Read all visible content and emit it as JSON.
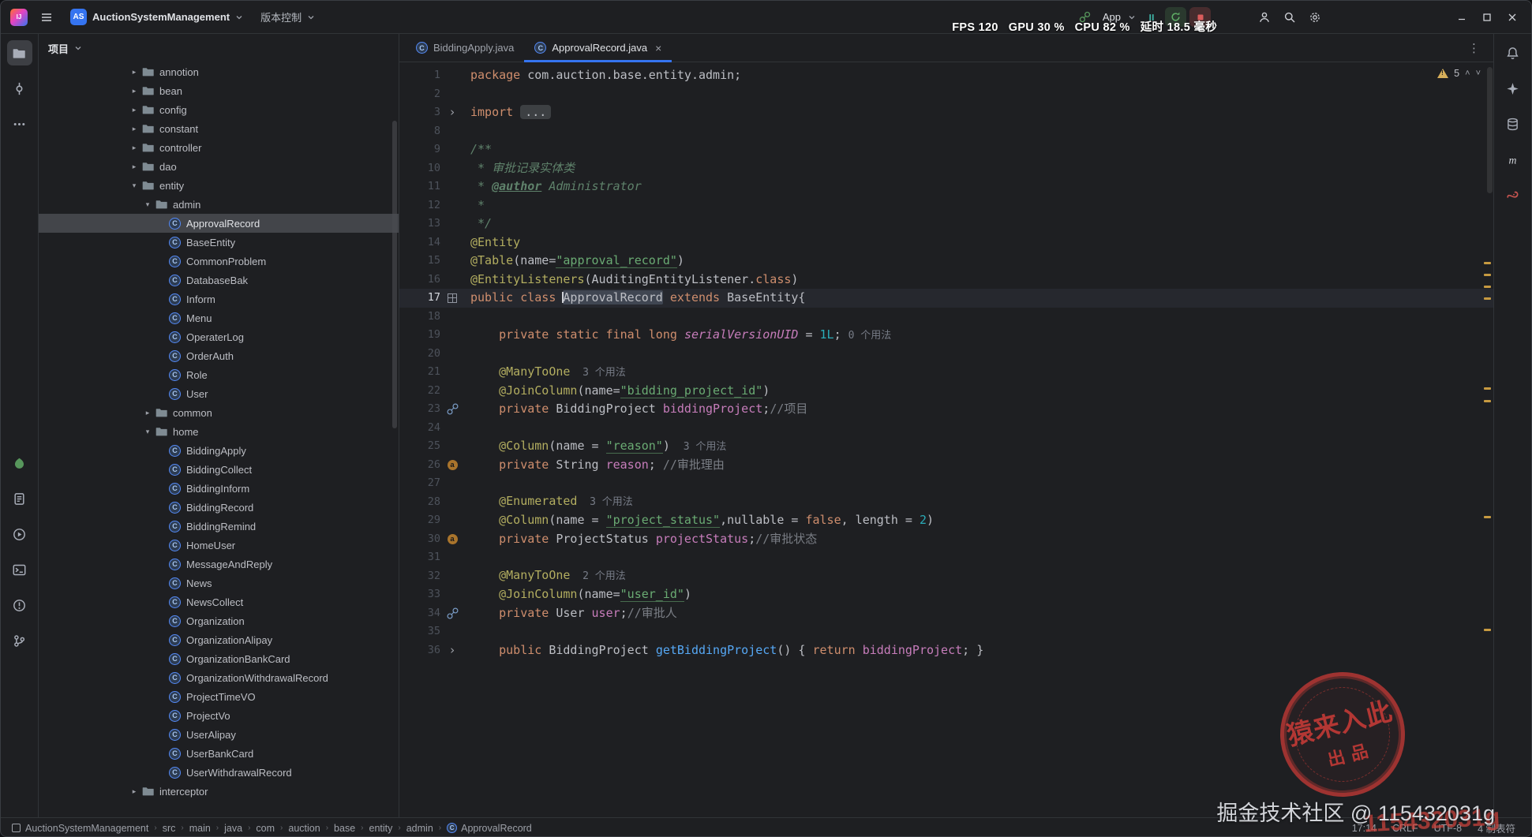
{
  "titlebar": {
    "project_abbrev": "AS",
    "project_name": "AuctionSystemManagement",
    "vcs_widget": "版本控制",
    "run_config": "App",
    "perf_text": "FPS 120   GPU 30 %   CPU 82 %   延时 18.5 毫秒"
  },
  "panel": {
    "title": "项目"
  },
  "tree": {
    "items": [
      {
        "label": "annotion",
        "depth": 0,
        "kind": "folder",
        "state": "c"
      },
      {
        "label": "bean",
        "depth": 0,
        "kind": "folder",
        "state": "c"
      },
      {
        "label": "config",
        "depth": 0,
        "kind": "folder",
        "state": "c"
      },
      {
        "label": "constant",
        "depth": 0,
        "kind": "folder",
        "state": "c"
      },
      {
        "label": "controller",
        "depth": 0,
        "kind": "folder",
        "state": "c"
      },
      {
        "label": "dao",
        "depth": 0,
        "kind": "folder",
        "state": "c"
      },
      {
        "label": "entity",
        "depth": 0,
        "kind": "folder",
        "state": "e"
      },
      {
        "label": "admin",
        "depth": 1,
        "kind": "folder",
        "state": "e"
      },
      {
        "label": "ApprovalRecord",
        "depth": 2,
        "kind": "class",
        "selected": true
      },
      {
        "label": "BaseEntity",
        "depth": 2,
        "kind": "class"
      },
      {
        "label": "CommonProblem",
        "depth": 2,
        "kind": "class"
      },
      {
        "label": "DatabaseBak",
        "depth": 2,
        "kind": "class"
      },
      {
        "label": "Inform",
        "depth": 2,
        "kind": "class"
      },
      {
        "label": "Menu",
        "depth": 2,
        "kind": "class"
      },
      {
        "label": "OperaterLog",
        "depth": 2,
        "kind": "class"
      },
      {
        "label": "OrderAuth",
        "depth": 2,
        "kind": "class"
      },
      {
        "label": "Role",
        "depth": 2,
        "kind": "class"
      },
      {
        "label": "User",
        "depth": 2,
        "kind": "class"
      },
      {
        "label": "common",
        "depth": 1,
        "kind": "folder",
        "state": "c"
      },
      {
        "label": "home",
        "depth": 1,
        "kind": "folder",
        "state": "e"
      },
      {
        "label": "BiddingApply",
        "depth": 2,
        "kind": "class"
      },
      {
        "label": "BiddingCollect",
        "depth": 2,
        "kind": "class"
      },
      {
        "label": "BiddingInform",
        "depth": 2,
        "kind": "class"
      },
      {
        "label": "BiddingRecord",
        "depth": 2,
        "kind": "class"
      },
      {
        "label": "BiddingRemind",
        "depth": 2,
        "kind": "class"
      },
      {
        "label": "HomeUser",
        "depth": 2,
        "kind": "class"
      },
      {
        "label": "MessageAndReply",
        "depth": 2,
        "kind": "class"
      },
      {
        "label": "News",
        "depth": 2,
        "kind": "class"
      },
      {
        "label": "NewsCollect",
        "depth": 2,
        "kind": "class"
      },
      {
        "label": "Organization",
        "depth": 2,
        "kind": "class"
      },
      {
        "label": "OrganizationAlipay",
        "depth": 2,
        "kind": "class"
      },
      {
        "label": "OrganizationBankCard",
        "depth": 2,
        "kind": "class"
      },
      {
        "label": "OrganizationWithdrawalRecord",
        "depth": 2,
        "kind": "class"
      },
      {
        "label": "ProjectTimeVO",
        "depth": 2,
        "kind": "class"
      },
      {
        "label": "ProjectVo",
        "depth": 2,
        "kind": "class"
      },
      {
        "label": "UserAlipay",
        "depth": 2,
        "kind": "class"
      },
      {
        "label": "UserBankCard",
        "depth": 2,
        "kind": "class"
      },
      {
        "label": "UserWithdrawalRecord",
        "depth": 2,
        "kind": "class"
      },
      {
        "label": "interceptor",
        "depth": 0,
        "kind": "folder",
        "state": "c"
      }
    ]
  },
  "tabs": [
    {
      "label": "BiddingApply.java",
      "active": false
    },
    {
      "label": "ApprovalRecord.java",
      "active": true
    }
  ],
  "editor": {
    "inspections": {
      "warnings": "5"
    },
    "lines": [
      {
        "n": "1",
        "s": [
          [
            "kw",
            "package "
          ],
          [
            "pl",
            "com.auction.base.entity.admin;"
          ]
        ]
      },
      {
        "n": "2",
        "s": []
      },
      {
        "n": "3",
        "g": "fold",
        "s": [
          [
            "kw",
            "import "
          ],
          [
            "foldb",
            "..."
          ]
        ]
      },
      {
        "n": "8",
        "s": []
      },
      {
        "n": "9",
        "s": [
          [
            "doc",
            "/**"
          ]
        ]
      },
      {
        "n": "10",
        "s": [
          [
            "doc",
            " * 审批记录实体类"
          ]
        ]
      },
      {
        "n": "11",
        "s": [
          [
            "doc",
            " * "
          ],
          [
            "dtag",
            "@author"
          ],
          [
            "doc",
            " Administrator"
          ]
        ]
      },
      {
        "n": "12",
        "s": [
          [
            "doc",
            " *"
          ]
        ]
      },
      {
        "n": "13",
        "s": [
          [
            "doc",
            " */"
          ]
        ]
      },
      {
        "n": "14",
        "s": [
          [
            "ann",
            "@Entity"
          ]
        ]
      },
      {
        "n": "15",
        "s": [
          [
            "ann",
            "@Table"
          ],
          [
            "pl",
            "(name="
          ],
          [
            "su",
            "\"approval_record\""
          ],
          [
            "pl",
            ")"
          ]
        ]
      },
      {
        "n": "16",
        "s": [
          [
            "ann",
            "@EntityListeners"
          ],
          [
            "pl",
            "(AuditingEntityListener."
          ],
          [
            "kw",
            "class"
          ],
          [
            "pl",
            ")"
          ]
        ]
      },
      {
        "n": "17",
        "cur": true,
        "g": "entity",
        "s": [
          [
            "kw",
            "public class "
          ],
          [
            "hlt",
            "ApprovalRecord"
          ],
          [
            "kw",
            " extends "
          ],
          [
            "pl",
            "BaseEntity{"
          ]
        ]
      },
      {
        "n": "18",
        "s": []
      },
      {
        "n": "19",
        "s": [
          [
            "kw",
            "    private static final long "
          ],
          [
            "flds",
            "serialVersionUID"
          ],
          [
            "pl",
            " = "
          ],
          [
            "num",
            "1L"
          ],
          [
            "pl",
            "; "
          ],
          [
            "hint",
            "0 个用法"
          ]
        ]
      },
      {
        "n": "20",
        "s": []
      },
      {
        "n": "21",
        "s": [
          [
            "ann",
            "    @ManyToOne"
          ],
          [
            "hint",
            "  3 个用法"
          ]
        ]
      },
      {
        "n": "22",
        "s": [
          [
            "ann",
            "    @JoinColumn"
          ],
          [
            "pl",
            "(name="
          ],
          [
            "su",
            "\"bidding_project_id\""
          ],
          [
            "pl",
            ")"
          ]
        ]
      },
      {
        "n": "23",
        "g": "link",
        "s": [
          [
            "kw",
            "    private "
          ],
          [
            "pl",
            "BiddingProject "
          ],
          [
            "fld",
            "biddingProject"
          ],
          [
            "pl",
            ";"
          ],
          [
            "cmt",
            "//项目"
          ]
        ]
      },
      {
        "n": "24",
        "s": []
      },
      {
        "n": "25",
        "s": [
          [
            "ann",
            "    @Column"
          ],
          [
            "pl",
            "(name = "
          ],
          [
            "su",
            "\"reason\""
          ],
          [
            "pl",
            ") "
          ],
          [
            "hint",
            " 3 个用法"
          ]
        ]
      },
      {
        "n": "26",
        "g": "attr",
        "s": [
          [
            "kw",
            "    private "
          ],
          [
            "pl",
            "String "
          ],
          [
            "fld",
            "reason"
          ],
          [
            "pl",
            "; "
          ],
          [
            "cmt",
            "//审批理由"
          ]
        ]
      },
      {
        "n": "27",
        "s": []
      },
      {
        "n": "28",
        "s": [
          [
            "ann",
            "    @Enumerated"
          ],
          [
            "hint",
            "  3 个用法"
          ]
        ]
      },
      {
        "n": "29",
        "s": [
          [
            "ann",
            "    @Column"
          ],
          [
            "pl",
            "(name = "
          ],
          [
            "su",
            "\"project_status\""
          ],
          [
            "pl",
            ",nullable = "
          ],
          [
            "kw",
            "false"
          ],
          [
            "pl",
            ", length = "
          ],
          [
            "num",
            "2"
          ],
          [
            "pl",
            ")"
          ]
        ]
      },
      {
        "n": "30",
        "g": "attr",
        "s": [
          [
            "kw",
            "    private "
          ],
          [
            "pl",
            "ProjectStatus "
          ],
          [
            "fld",
            "projectStatus"
          ],
          [
            "pl",
            ";"
          ],
          [
            "cmt",
            "//审批状态"
          ]
        ]
      },
      {
        "n": "31",
        "s": []
      },
      {
        "n": "32",
        "s": [
          [
            "ann",
            "    @ManyToOne"
          ],
          [
            "hint",
            "  2 个用法"
          ]
        ]
      },
      {
        "n": "33",
        "s": [
          [
            "ann",
            "    @JoinColumn"
          ],
          [
            "pl",
            "(name="
          ],
          [
            "su",
            "\"user_id\""
          ],
          [
            "pl",
            ")"
          ]
        ]
      },
      {
        "n": "34",
        "g": "link",
        "s": [
          [
            "kw",
            "    private "
          ],
          [
            "pl",
            "User "
          ],
          [
            "fld",
            "user"
          ],
          [
            "pl",
            ";"
          ],
          [
            "cmt",
            "//审批人"
          ]
        ]
      },
      {
        "n": "35",
        "s": []
      },
      {
        "n": "36",
        "g": "fold",
        "s": [
          [
            "kw",
            "    public "
          ],
          [
            "pl",
            "BiddingProject "
          ],
          [
            "mth",
            "getBiddingProject"
          ],
          [
            "pl",
            "() { "
          ],
          [
            "kw",
            "return "
          ],
          [
            "fld",
            "biddingProject"
          ],
          [
            "pl",
            "; }"
          ]
        ]
      }
    ]
  },
  "statusbar": {
    "breadcrumbs": [
      "AuctionSystemManagement",
      "src",
      "main",
      "java",
      "com",
      "auction",
      "base",
      "entity",
      "admin",
      "ApprovalRecord"
    ],
    "right": [
      "17:14",
      "CRLF",
      "UTF-8",
      "4 制表符"
    ]
  },
  "watermark": {
    "community": "掘金技术社区 @ 115432031g",
    "red_id": "115432031g",
    "stamp_main": "猿来入此",
    "stamp_sub": "出品"
  },
  "icons": {
    "left_top": [
      {
        "name": "project",
        "active": true
      },
      {
        "name": "commit"
      },
      {
        "name": "more"
      }
    ],
    "left_bottom": [
      {
        "name": "services"
      },
      {
        "name": "todo"
      },
      {
        "name": "run"
      },
      {
        "name": "terminal"
      },
      {
        "name": "problems"
      },
      {
        "name": "git"
      }
    ],
    "right_strip": [
      {
        "name": "notifications"
      },
      {
        "name": "ai-assistant"
      },
      {
        "name": "database"
      },
      {
        "name": "maven"
      },
      {
        "name": "gradle"
      }
    ]
  }
}
